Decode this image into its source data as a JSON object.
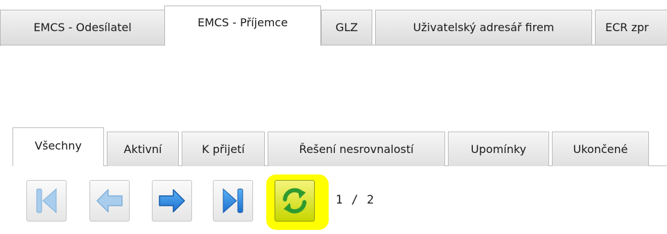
{
  "top_tabs": {
    "sender": "EMCS - Odesílatel",
    "recipient": "EMCS - Příjemce",
    "glz": "GLZ",
    "address_book": "Uživatelský adresář firem",
    "ecr": "ECR zpr"
  },
  "sub_tabs": {
    "all": "Všechny",
    "active": "Aktivní",
    "to_accept": "K přijetí",
    "discrepancy": "Řešení nesrovnalostí",
    "reminders": "Upomínky",
    "finished": "Ukončené"
  },
  "pager": {
    "page_info": "1 / 2",
    "icons": [
      "first-page-icon",
      "previous-page-icon",
      "next-page-icon",
      "last-page-icon",
      "refresh-icon"
    ]
  },
  "colors": {
    "highlight": "#ffff00",
    "nav_blue": "#2a8be0",
    "nav_blue_disabled": "#a9cdec",
    "refresh_green": "#2f9a2f"
  }
}
